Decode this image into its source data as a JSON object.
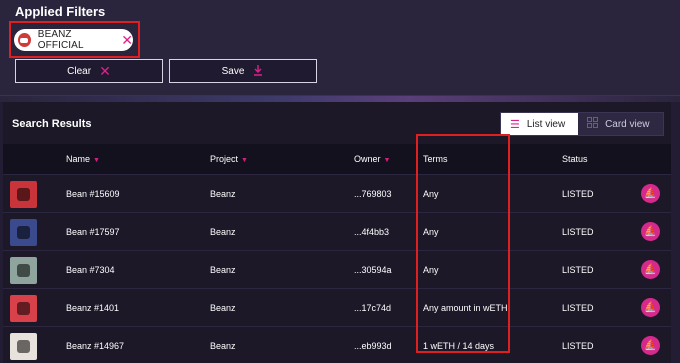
{
  "filters": {
    "title": "Applied Filters",
    "chip_label": "BEANZ OFFICIAL",
    "clear_label": "Clear",
    "save_label": "Save"
  },
  "results": {
    "title": "Search Results",
    "list_view_label": "List view",
    "card_view_label": "Card view"
  },
  "table": {
    "headers": {
      "name": "Name",
      "project": "Project",
      "owner": "Owner",
      "terms": "Terms",
      "status": "Status"
    },
    "rows": [
      {
        "name": "Bean #15609",
        "project": "Beanz",
        "owner": "...769803",
        "terms": "Any",
        "status": "LISTED",
        "avatar_color": "#c8343a"
      },
      {
        "name": "Bean #17597",
        "project": "Beanz",
        "owner": "...4f4bb3",
        "terms": "Any",
        "status": "LISTED",
        "avatar_color": "#3a4a8c"
      },
      {
        "name": "Bean #7304",
        "project": "Beanz",
        "owner": "...30594a",
        "terms": "Any",
        "status": "LISTED",
        "avatar_color": "#8fa49c"
      },
      {
        "name": "Beanz #1401",
        "project": "Beanz",
        "owner": "...17c74d",
        "terms": "Any amount in wETH",
        "status": "LISTED",
        "avatar_color": "#d8404a"
      },
      {
        "name": "Beanz #14967",
        "project": "Beanz",
        "owner": "...eb993d",
        "terms": "1 wETH / 14 days",
        "status": "LISTED",
        "avatar_color": "#e8e2dc"
      }
    ]
  },
  "colors": {
    "accent": "#e0208a",
    "highlight_outline": "#e02020"
  },
  "icons": {
    "chip_remove": "close-icon",
    "clear": "close-icon",
    "save": "download-icon",
    "list": "list-icon",
    "card": "grid-icon",
    "row_action": "sailboat-icon"
  }
}
